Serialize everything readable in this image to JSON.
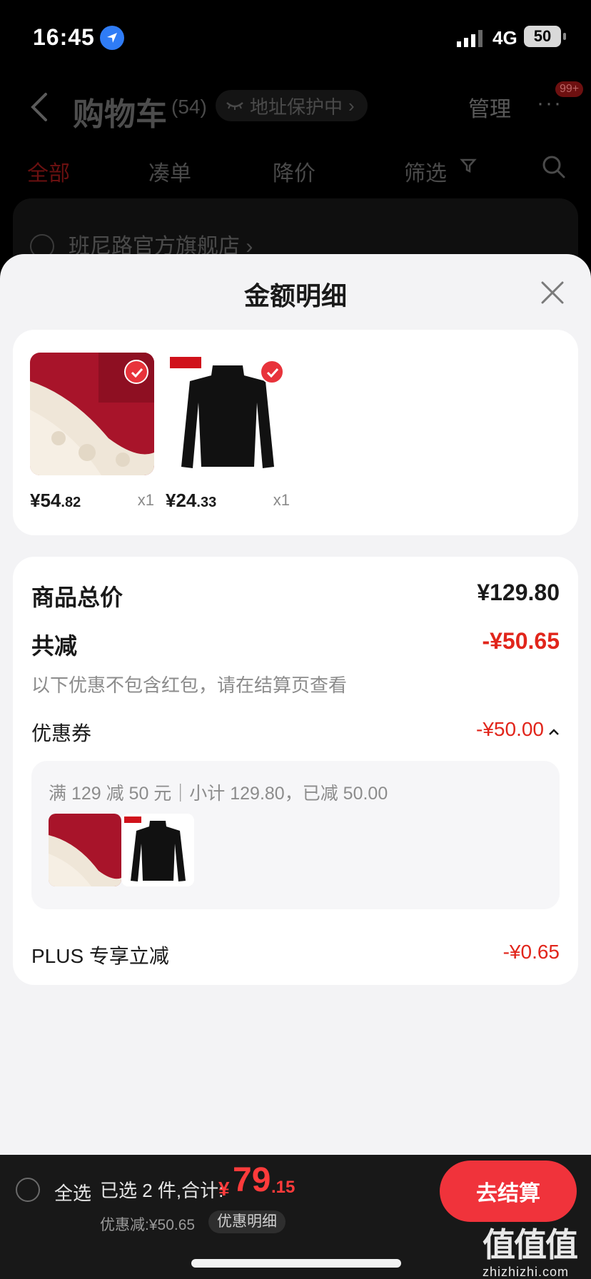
{
  "status_bar": {
    "time": "16:45",
    "network": "4G",
    "battery": "50"
  },
  "cart_header": {
    "title": "购物车",
    "count": "(54)",
    "address_protection": "地址保护中",
    "manage": "管理",
    "notification_badge": "99+",
    "tabs": [
      "全部",
      "凑单",
      "降价",
      "筛选"
    ],
    "store_name": "班尼路官方旗舰店"
  },
  "sheet": {
    "title": "金额明细",
    "products": [
      {
        "price_int": "¥54",
        "price_dec": ".82",
        "qty": "x1"
      },
      {
        "price_int": "¥24",
        "price_dec": ".33",
        "qty": "x1"
      }
    ],
    "summary": {
      "total_label": "商品总价",
      "total_value": "¥129.80",
      "reduce_label": "共减",
      "reduce_value": "-¥50.65",
      "note": "以下优惠不包含红包，请在结算页查看",
      "coupon_label": "优惠券",
      "coupon_value": "-¥50.00",
      "coupon_desc": "满 129 减 50 元｜小计 129.80，已减 50.00",
      "plus_label": "PLUS 专享立减",
      "plus_value": "-¥0.65"
    }
  },
  "bottom_bar": {
    "select_all": "全选",
    "selected_text": "已选 2 件,合计:",
    "total_yen": "¥",
    "total_int": "79",
    "total_dec": ".15",
    "discount_text": "优惠减:¥50.65",
    "detail_label": "优惠明细",
    "checkout_label": "去结算"
  },
  "watermark": {
    "big": "值值值",
    "small": "zhizhizhi.com"
  },
  "colors": {
    "accent_red": "#e1251b",
    "button_red": "#f0333b",
    "sheet_bg": "#f3f3f5"
  }
}
